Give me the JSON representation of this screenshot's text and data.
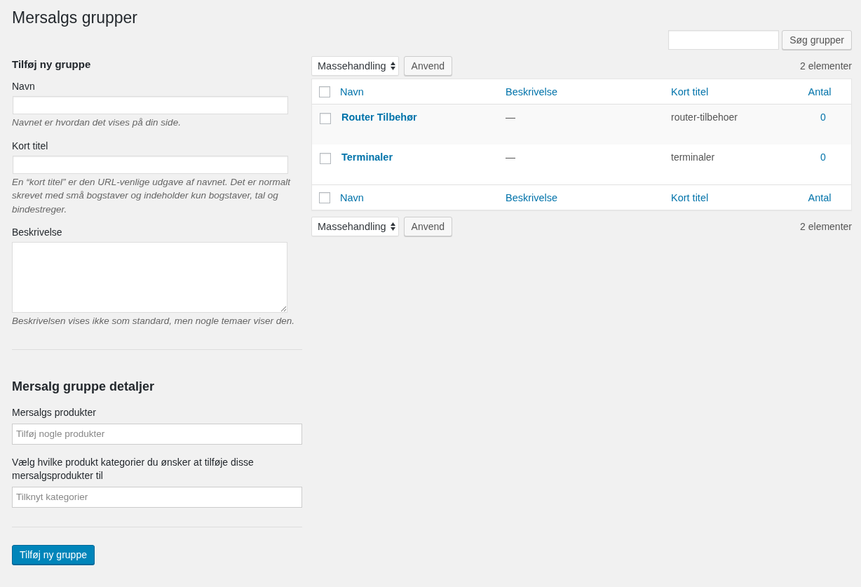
{
  "page_title": "Mersalgs grupper",
  "search": {
    "button": "Søg grupper"
  },
  "add_group": {
    "heading": "Tilføj ny gruppe",
    "fields": [
      {
        "kind": "input",
        "label": "Navn",
        "hint": "Navnet er hvordan det vises på din side."
      },
      {
        "kind": "input",
        "label": "Kort titel",
        "hint": "En “kort titel” er den URL-venlige udgave af navnet. Det er normalt skrevet med små bogstaver og indeholder kun bogstaver, tal og bindestreger."
      },
      {
        "kind": "textarea",
        "label": "Beskrivelse",
        "hint": "Beskrivelsen vises ikke som standard, men nogle temaer viser den."
      }
    ]
  },
  "details": {
    "heading": "Mersalg gruppe detaljer",
    "fields": [
      {
        "label": "Mersalgs produkter",
        "placeholder": "Tilføj nogle produkter"
      },
      {
        "label": "Vælg hvilke produkt kategorier du ønsker at tilføje disse mersalgsprodukter til",
        "placeholder": "Tilknyt kategorier"
      }
    ]
  },
  "submit": "Tilføj ny gruppe",
  "table": {
    "top_nav": {
      "bulk_action": "Massehandling",
      "apply": "Anvend",
      "count": "2 elementer"
    },
    "header": {
      "select_all_checked": false,
      "columns": [
        "Navn",
        "Beskrivelse",
        "Kort titel",
        "Antal"
      ]
    },
    "rows": [
      {
        "name": "Router Tilbehør",
        "description": "—",
        "slug": "router-tilbehoer",
        "count": "0",
        "checked": false
      },
      {
        "name": "Terminaler",
        "description": "—",
        "slug": "terminaler",
        "count": "0",
        "checked": false
      }
    ],
    "footer": {
      "select_all_checked": false,
      "columns": [
        "Navn",
        "Beskrivelse",
        "Kort titel",
        "Antal"
      ]
    },
    "bottom_nav": {
      "bulk_action": "Massehandling",
      "apply": "Anvend",
      "count": "2 elementer"
    }
  }
}
